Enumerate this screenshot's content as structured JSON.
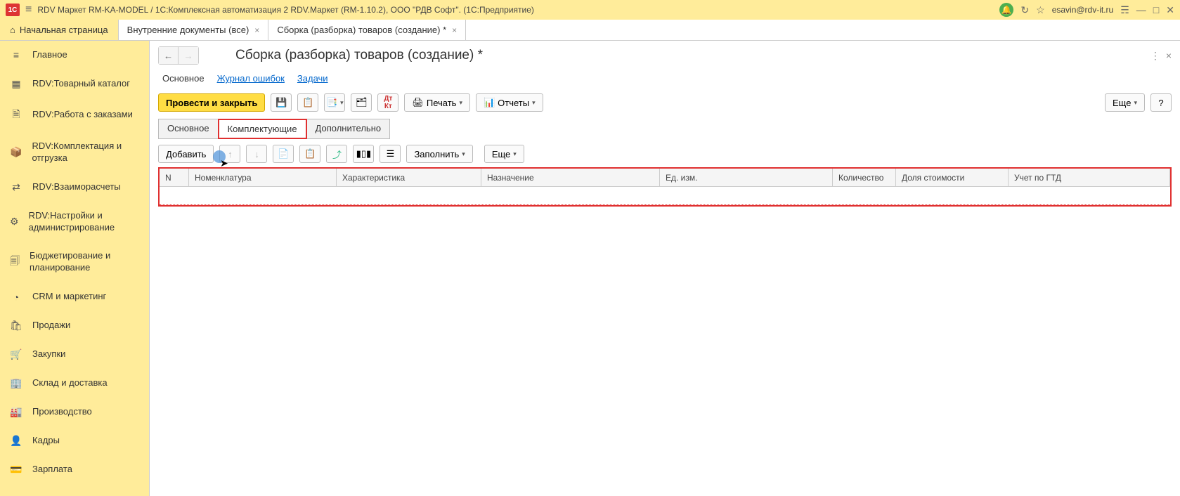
{
  "titlebar": {
    "logo": "1C",
    "title": "RDV Маркет RM-KA-MODEL / 1С:Комплексная автоматизация 2 RDV.Маркет (RM-1.10.2), ООО \"РДВ Софт\".  (1С:Предприятие)",
    "user": "esavin@rdv-it.ru"
  },
  "tabs": {
    "home": "Начальная страница",
    "items": [
      {
        "label": "Внутренние документы (все)"
      },
      {
        "label": "Сборка (разборка) товаров (создание) *"
      }
    ]
  },
  "sidebar": {
    "items": [
      {
        "icon": "≡",
        "label": "Главное"
      },
      {
        "icon": "▦",
        "label": "RDV:Товарный каталог"
      },
      {
        "icon": "🗎",
        "label": "RDV:Работа с заказами"
      },
      {
        "icon": "📦",
        "label": "RDV:Комплектация и отгрузка"
      },
      {
        "icon": "⇄",
        "label": "RDV:Взаиморасчеты"
      },
      {
        "icon": "⚙",
        "label": "RDV:Настройки и администрирование"
      },
      {
        "icon": "🗐",
        "label": "Бюджетирование и планирование"
      },
      {
        "icon": "◔",
        "label": "CRM и маркетинг"
      },
      {
        "icon": "🛍",
        "label": "Продажи"
      },
      {
        "icon": "🛒",
        "label": "Закупки"
      },
      {
        "icon": "🏢",
        "label": "Склад и доставка"
      },
      {
        "icon": "🏭",
        "label": "Производство"
      },
      {
        "icon": "👤",
        "label": "Кадры"
      },
      {
        "icon": "💳",
        "label": "Зарплата"
      }
    ]
  },
  "page": {
    "title": "Сборка (разборка) товаров (создание) *",
    "links": {
      "main": "Основное",
      "error_log": "Журнал ошибок",
      "tasks": "Задачи"
    },
    "toolbar": {
      "post_and_close": "Провести и закрыть",
      "print": "Печать",
      "reports": "Отчеты",
      "more": "Еще"
    },
    "inner_tabs": {
      "main": "Основное",
      "components": "Комплектующие",
      "additional": "Дополнительно"
    },
    "table_toolbar": {
      "add": "Добавить",
      "fill": "Заполнить",
      "more": "Еще"
    },
    "columns": {
      "n": "N",
      "nomenclature": "Номенклатура",
      "characteristic": "Характеристика",
      "purpose": "Назначение",
      "unit": "Ед. изм.",
      "quantity": "Количество",
      "cost_share": "Доля стоимости",
      "gtd": "Учет по ГТД"
    }
  }
}
